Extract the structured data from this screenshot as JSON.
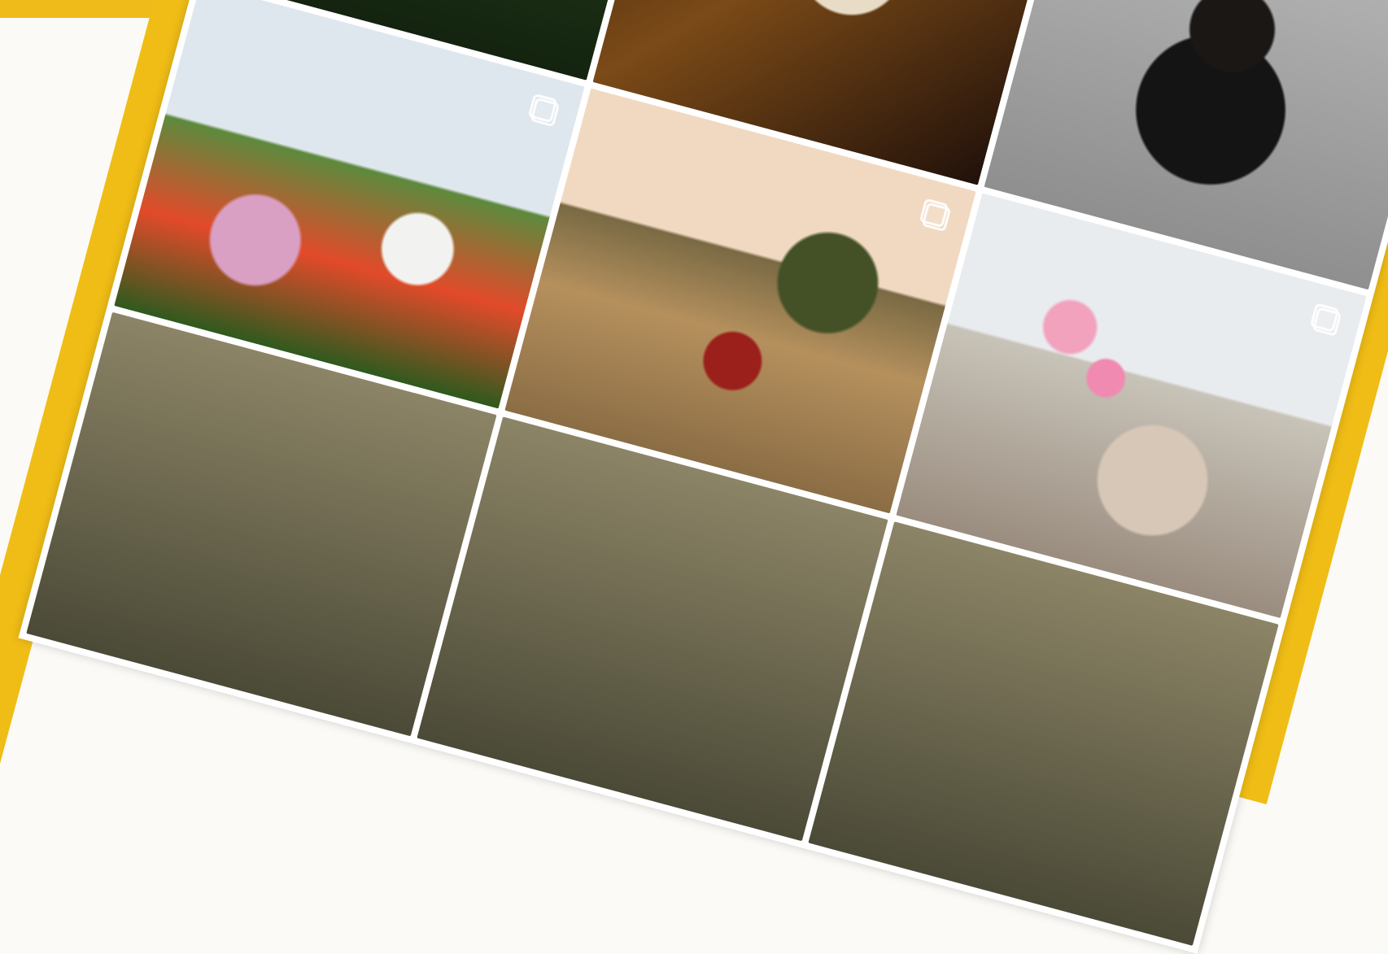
{
  "theme": {
    "accent": "#efbb1a",
    "background": "#fbfaf6",
    "phone_background": "#ffffff",
    "icon_color": "#8e8e8e"
  },
  "icons": {
    "profile_camera": "profile-camera-icon",
    "pin": "pin-icon",
    "multiple_photos": "multiple-photos-icon"
  },
  "grid": {
    "tiles": [
      {
        "name": "flowers-post"
      },
      {
        "name": "couple-post",
        "overlay": "pin-icon"
      },
      {
        "name": "photographer-post",
        "overlay": "pin-icon"
      },
      {
        "name": "family-field-post",
        "overlay": "multiple-photos-icon"
      },
      {
        "name": "golden-field-post",
        "overlay": "multiple-photos-icon"
      },
      {
        "name": "balloons-family-post",
        "overlay": "multiple-photos-icon"
      },
      {
        "name": "grass-post-1"
      },
      {
        "name": "grass-post-2"
      },
      {
        "name": "grass-post-3"
      }
    ]
  }
}
